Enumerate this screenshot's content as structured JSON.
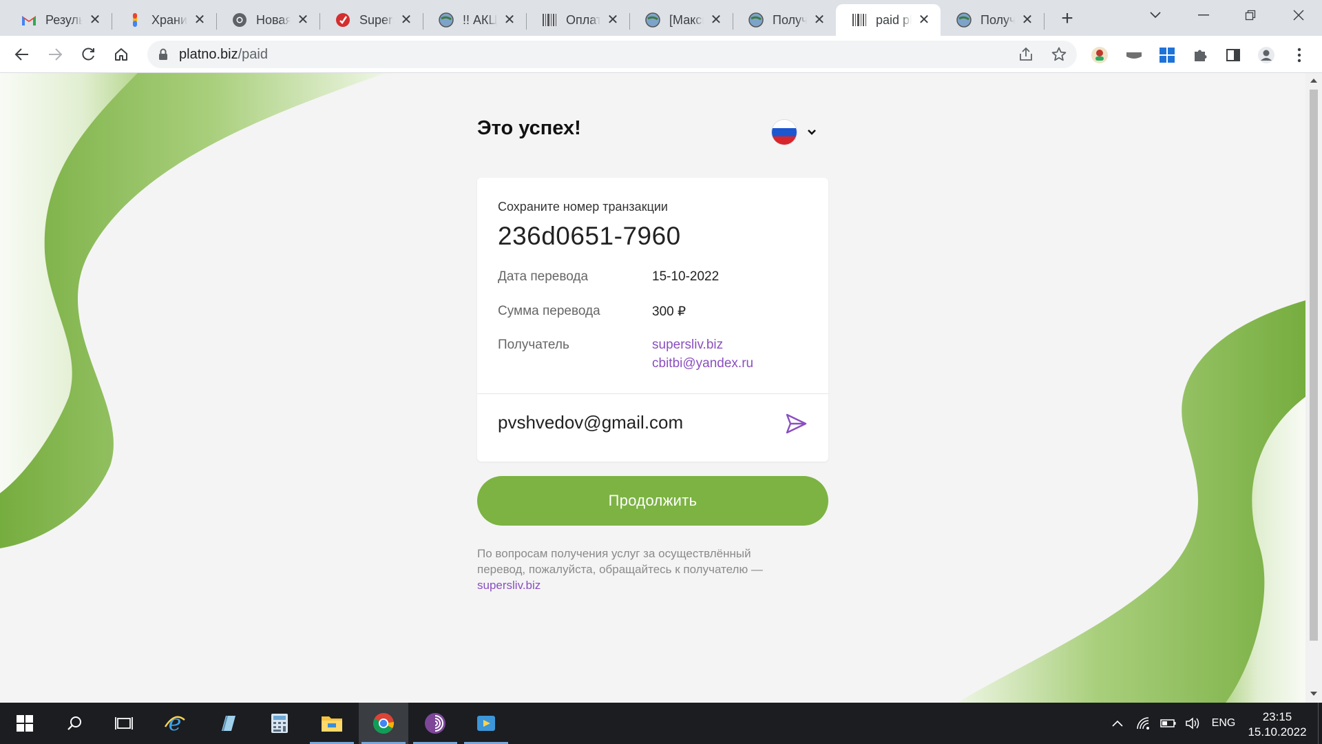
{
  "browser": {
    "tabs": [
      {
        "title": "Результаты поиска",
        "favicon": "gmail-icon"
      },
      {
        "title": "Хранилище",
        "favicon": "google-drive-icon"
      },
      {
        "title": "Новая вкладка",
        "favicon": "chrome-icon"
      },
      {
        "title": "Supersliv",
        "favicon": "supersliv-icon"
      },
      {
        "title": "!! АКЦИЯ",
        "favicon": "globe-icon"
      },
      {
        "title": "Оплата",
        "favicon": "barcode-icon"
      },
      {
        "title": "[Максим]",
        "favicon": "globe-icon"
      },
      {
        "title": "Получение",
        "favicon": "globe-icon"
      },
      {
        "title": "paid platno.biz",
        "favicon": "barcode-icon",
        "active": true
      },
      {
        "title": "Получение",
        "favicon": "globe-icon"
      }
    ],
    "address": {
      "host": "platno.biz",
      "path": "/paid"
    }
  },
  "page": {
    "heading": "Это успех!",
    "language": "ru",
    "card": {
      "save_label": "Сохраните номер транзакции",
      "transaction_id": "236d0651-7960",
      "date_label": "Дата перевода",
      "date_value": "15-10-2022",
      "amount_label": "Сумма перевода",
      "amount_value": "300 ₽",
      "recipient_label": "Получатель",
      "recipient_site": "supersliv.biz",
      "recipient_email": "cbitbi@yandex.ru",
      "email_value": "pvshvedov@gmail.com"
    },
    "continue_button": "Продолжить",
    "note_text": "По вопросам получения услуг за осуществлённый перевод, пожалуйста, обращайтесь к получателю —",
    "note_link": "supersliv.biz"
  },
  "taskbar": {
    "language": "ENG",
    "time": "23:15",
    "date": "15.10.2022"
  },
  "colors": {
    "accent_green": "#7cb342",
    "link_purple": "#8a4fbf"
  }
}
